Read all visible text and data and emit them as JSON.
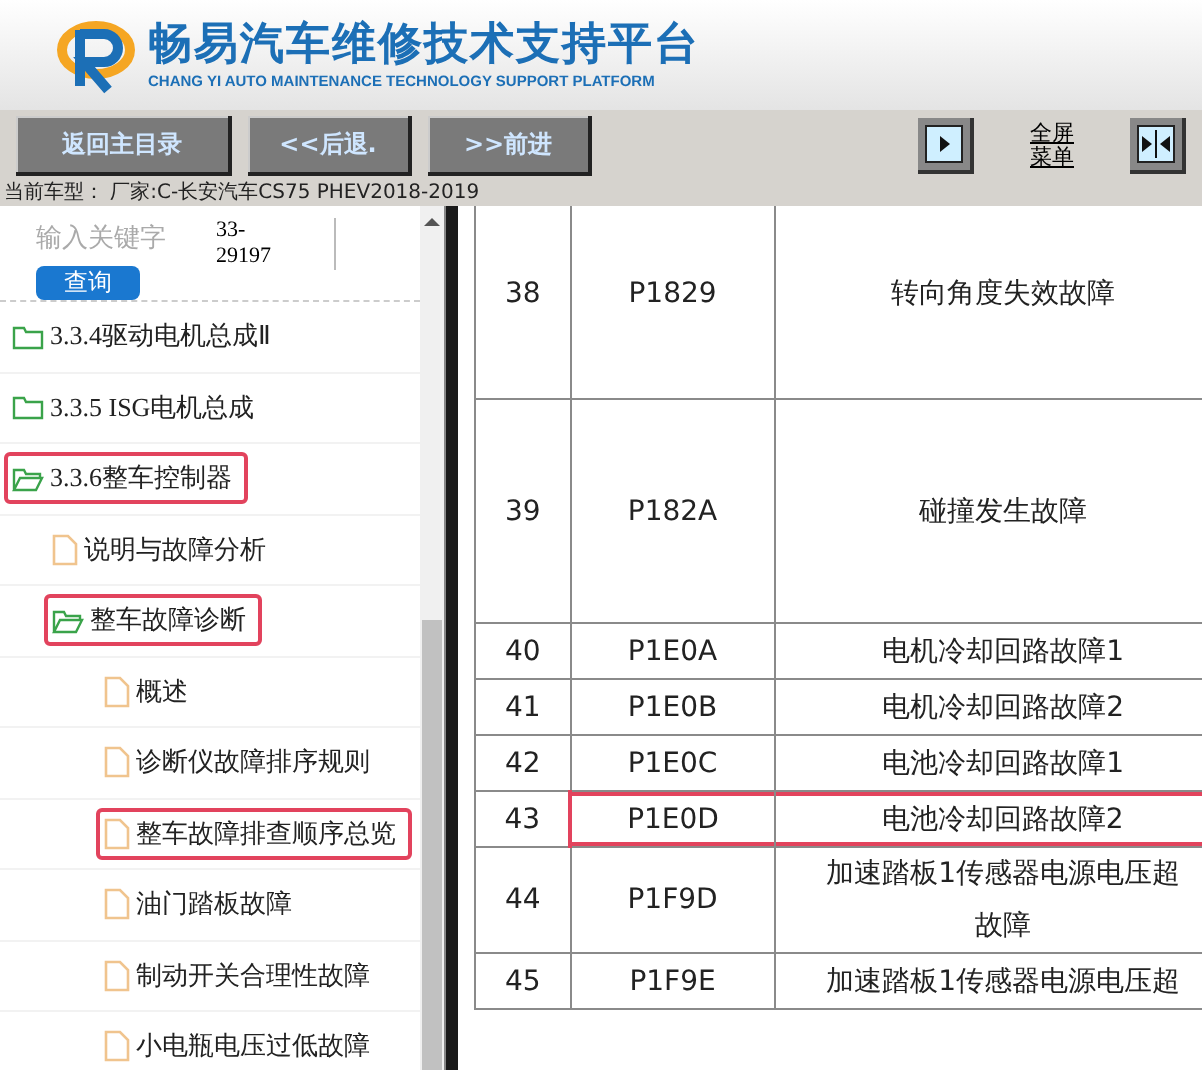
{
  "header": {
    "title": "畅易汽车维修技术支持平台",
    "subtitle": "CHANG YI AUTO MAINTENANCE TECHNOLOGY SUPPORT PLATFORM"
  },
  "toolbar": {
    "buttons": [
      "返回主目录",
      "<<后退.",
      ">>前进"
    ],
    "fullscreen_menu": [
      "全屏",
      "菜单"
    ]
  },
  "car_model": "当前车型：  厂家:C-长安汽车CS75 PHEV2018-2019",
  "search": {
    "placeholder": "输入关键字",
    "code": "33-\n29197",
    "button": "查询"
  },
  "tree": [
    {
      "label": "3.3.4驱动电机总成Ⅱ",
      "kind": "folder",
      "expanded": false,
      "highlighted": false
    },
    {
      "label": "3.3.5 ISG电机总成",
      "kind": "folder",
      "expanded": false,
      "highlighted": false
    },
    {
      "label": "3.3.6整车控制器",
      "kind": "folder",
      "expanded": true,
      "highlighted": true,
      "children": [
        {
          "label": "说明与故障分析",
          "kind": "file",
          "highlighted": false
        },
        {
          "label": "整车故障诊断",
          "kind": "folder",
          "expanded": true,
          "highlighted": true,
          "children": [
            {
              "label": "概述",
              "kind": "file",
              "highlighted": false
            },
            {
              "label": "诊断仪故障排序规则",
              "kind": "file",
              "highlighted": false
            },
            {
              "label": "整车故障排查顺序总览",
              "kind": "file",
              "highlighted": true
            },
            {
              "label": "油门踏板故障",
              "kind": "file",
              "highlighted": false
            },
            {
              "label": "制动开关合理性故障",
              "kind": "file",
              "highlighted": false
            },
            {
              "label": "小电瓶电压过低故障",
              "kind": "file",
              "highlighted": false
            }
          ]
        }
      ]
    }
  ],
  "table": {
    "rows": [
      {
        "no": "38",
        "code": "P1829",
        "description": [
          "转向角度失效故障"
        ],
        "highlighted": false
      },
      {
        "no": "39",
        "code": "P182A",
        "description": [
          "碰撞发生故障"
        ],
        "highlighted": false
      },
      {
        "no": "40",
        "code": "P1E0A",
        "description": [
          "电机冷却回路故障1"
        ],
        "highlighted": false
      },
      {
        "no": "41",
        "code": "P1E0B",
        "description": [
          "电机冷却回路故障2"
        ],
        "highlighted": false
      },
      {
        "no": "42",
        "code": "P1E0C",
        "description": [
          "电池冷却回路故障1"
        ],
        "highlighted": false
      },
      {
        "no": "43",
        "code": "P1E0D",
        "description": [
          "电池冷却回路故障2"
        ],
        "highlighted": true
      },
      {
        "no": "44",
        "code": "P1F9D",
        "description": [
          "加速踏板1传感器电源电压超",
          "故障"
        ],
        "highlighted": false
      },
      {
        "no": "45",
        "code": "P1F9E",
        "description": [
          "加速踏板1传感器电源电压超"
        ],
        "highlighted": false
      }
    ]
  }
}
